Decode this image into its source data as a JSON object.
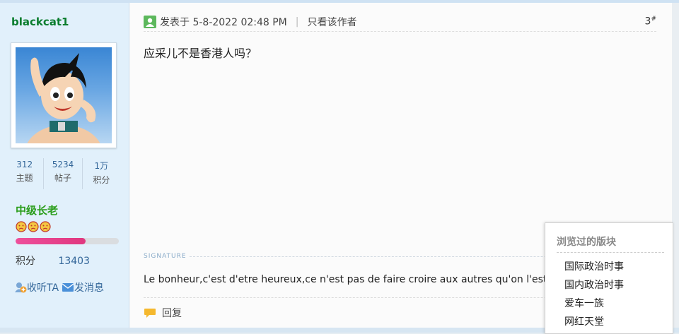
{
  "user": {
    "username": "blackcat1",
    "stats": [
      {
        "value": "312",
        "label": "主题"
      },
      {
        "value": "5234",
        "label": "帖子"
      },
      {
        "value": "1万",
        "label": "积分"
      }
    ],
    "rank": "中级长老",
    "rank_icon_count": 3,
    "progress_fraction": 0.68,
    "points_label": "积分",
    "points_value": "13403",
    "follow_label": "收听TA",
    "message_label": "发消息"
  },
  "post": {
    "posted_text": "发表于 5-8-2022 02:48 PM",
    "separator": "|",
    "only_author_label": "只看该作者",
    "floor_number": "3",
    "floor_mark": "#",
    "body": "应采儿不是香港人吗？",
    "signature_label": "SIGNATURE",
    "signature_text": "Le bonheur,c'est d'etre heureux,ce n'est pas de faire croire aux autres qu'on l'est",
    "reply_label": "回复"
  },
  "popup": {
    "title": "浏览过的版块",
    "items": [
      "国际政治时事",
      "国内政治时事",
      "爱车一族",
      "网红天堂"
    ]
  },
  "colors": {
    "sidebar_bg": "#e1f0fb",
    "username": "#0a7d2e",
    "rank": "#2a9d1a",
    "link": "#336699",
    "progress": "#e0377f"
  }
}
